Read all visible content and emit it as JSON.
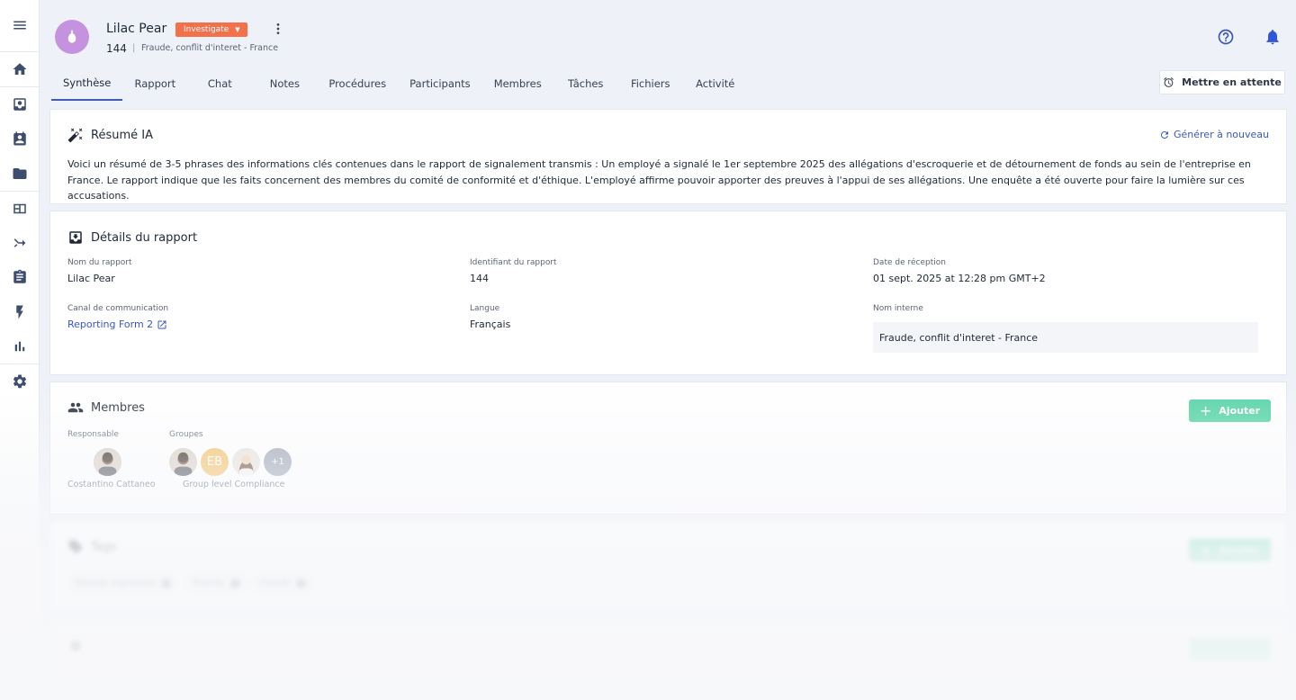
{
  "sidebar": {
    "items": [
      {
        "icon": "menu-icon"
      },
      {
        "icon": "home-icon"
      },
      {
        "icon": "inbox-icon"
      },
      {
        "icon": "contact-calendar-icon"
      },
      {
        "icon": "folder-icon"
      },
      {
        "icon": "table-icon"
      },
      {
        "icon": "merge-icon"
      },
      {
        "icon": "clipboard-icon"
      },
      {
        "icon": "bolt-icon"
      },
      {
        "icon": "bar-chart-icon"
      },
      {
        "icon": "gear-icon"
      }
    ]
  },
  "header": {
    "title": "Lilac Pear",
    "status": "Investigate",
    "case_id": "144",
    "separator": "|",
    "subtitle": "Fraude, conflit d'interet - France"
  },
  "tabs": [
    "Synthèse",
    "Rapport",
    "Chat",
    "Notes",
    "Procédures",
    "Participants",
    "Membres",
    "Tâches",
    "Fichiers",
    "Activité"
  ],
  "hold_button": "Mettre en attente",
  "ai_summary": {
    "title": "Résumé IA",
    "regenerate": "Générer à nouveau",
    "text": "Voici un résumé de 3-5 phrases des informations clés contenues dans le rapport de signalement transmis : Un employé a signalé le 1er septembre 2025 des allégations d'escroquerie et de détournement de fonds au sein de l'entreprise en France. Le rapport indique que les faits concernent des membres du comité de conformité et d'éthique. L'employé affirme pouvoir apporter des preuves à l'appui de ses allégations. Une enquête a été ouverte pour faire la lumière sur ces accusations."
  },
  "details": {
    "title": "Détails du rapport",
    "report_name_label": "Nom du rapport",
    "report_name": "Lilac Pear",
    "report_id_label": "Identifiant du rapport",
    "report_id": "144",
    "received_label": "Date de réception",
    "received": "01 sept. 2025 at 12:28 pm GMT+2",
    "channel_label": "Canal de communication",
    "channel": "Reporting Form 2",
    "language_label": "Langue",
    "language": "Français",
    "internal_name_label": "Nom interne",
    "internal_name": "Fraude, conflit d'interet - France"
  },
  "members": {
    "title": "Membres",
    "add": "Ajouter",
    "responsible_label": "Responsable",
    "responsible_name": "Costantino Cattaneo",
    "groups_label": "Groupes",
    "group_initials": "EB",
    "group_extra": "+1",
    "group_name": "Group level Compliance"
  },
  "tags": {
    "title": "Tags",
    "add": "Ajouter",
    "items": [
      "Whistle Important",
      "Priority",
      "Fraude"
    ]
  },
  "colors": {
    "accent": "#3f5bb5",
    "status": "#f2714b",
    "add_button": "#52d3a4",
    "avatar_main": "#c592e0"
  }
}
